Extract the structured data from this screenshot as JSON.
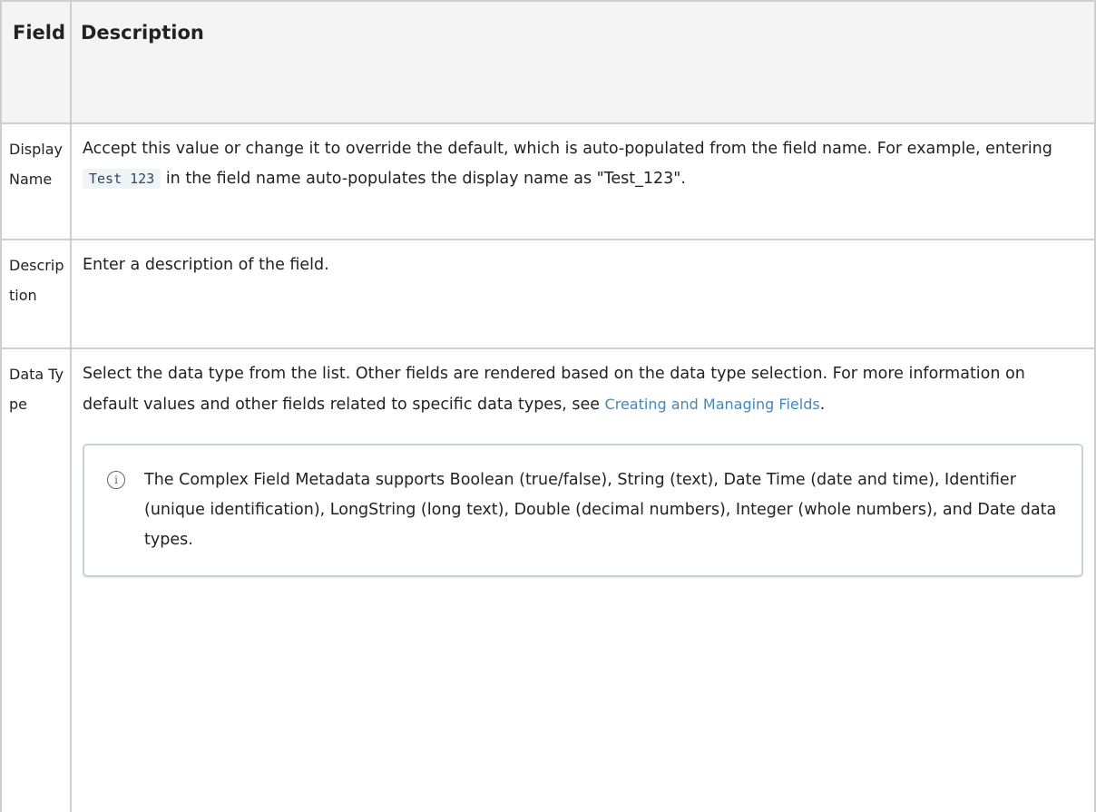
{
  "table": {
    "headers": {
      "field": "Field",
      "description": "Description"
    },
    "rows": [
      {
        "field": "Display Name",
        "desc_before": "Accept this value or change it to override the default, which is auto-populated from the field name. For example, entering ",
        "code": "Test 123",
        "desc_after": " in the field name auto-populates the display name as \"Test_123\"."
      },
      {
        "field": "Description",
        "desc": "Enter a description of the field."
      },
      {
        "field": "Data Type",
        "desc_before": "Select the data type from the list. Other fields are rendered based on the data type selection. For more information on default values and other fields related to specific data types, see ",
        "link": "Creating and Managing Fields",
        "desc_after": ".",
        "note": {
          "icon": "info-icon",
          "text": "The Complex Field Metadata supports Boolean (true/false), String (text), Date Time (date and time), Identifier (unique identification), LongString (long text), Double (decimal numbers), Integer (whole numbers), and Date data types."
        }
      }
    ]
  },
  "colors": {
    "header_bg": "#f4f4f4",
    "border": "#cfcfcf",
    "link": "#4a86b8",
    "code_bg": "#f1f4f7",
    "note_border": "#c9d2da"
  }
}
